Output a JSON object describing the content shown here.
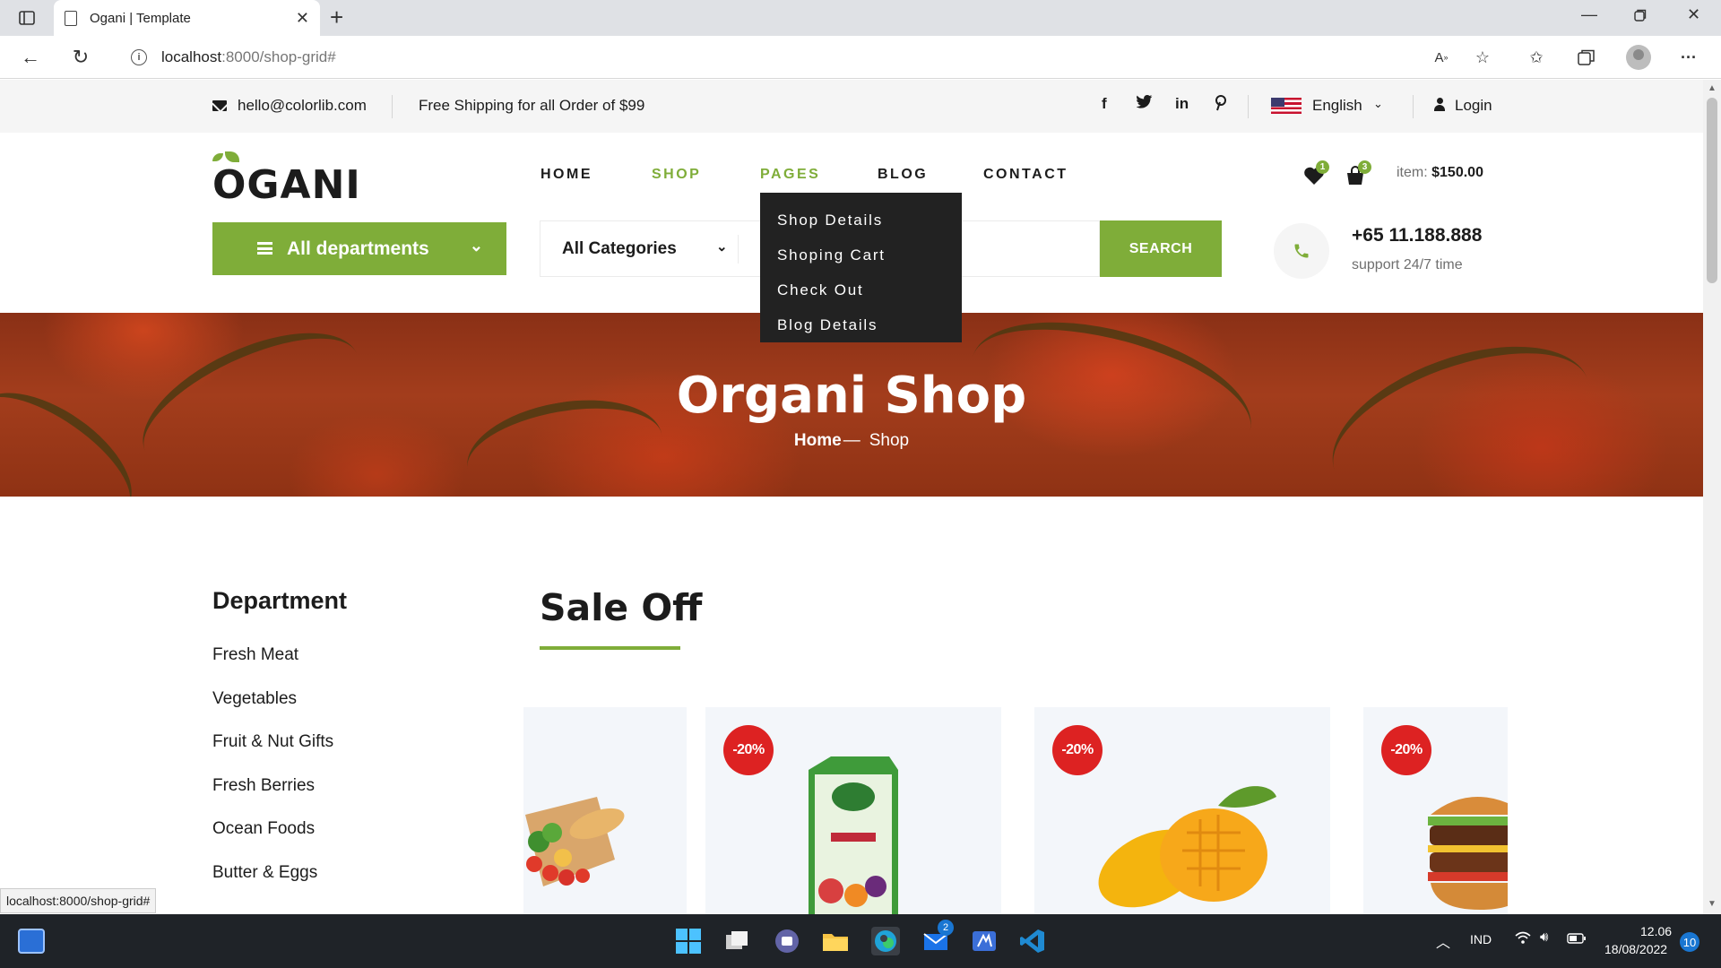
{
  "browser": {
    "tab_title": "Ogani | Template",
    "url_host": "localhost",
    "url_path": ":8000/shop-grid#",
    "status_url": "localhost:8000/shop-grid#"
  },
  "topbar": {
    "email": "hello@colorlib.com",
    "shipping": "Free Shipping for all Order of $99",
    "social": [
      "f",
      "t",
      "in",
      "p"
    ],
    "language": "English",
    "login": "Login"
  },
  "header": {
    "logo": "OGANI",
    "nav": [
      "HOME",
      "SHOP",
      "PAGES",
      "BLOG",
      "CONTACT"
    ],
    "wishlist_count": "1",
    "cart_count": "3",
    "item_label": "item:",
    "item_total": "$150.00",
    "pages_dropdown": [
      "Shop Details",
      "Shoping Cart",
      "Check Out",
      "Blog Details"
    ]
  },
  "search": {
    "departments": "All departments",
    "category": "All Categories",
    "placeholder": "",
    "button": "SEARCH"
  },
  "contact": {
    "phone": "+65 11.188.888",
    "support": "support 24/7 time"
  },
  "hero": {
    "title": "Organi Shop",
    "breadcrumb_home": "Home",
    "breadcrumb_sep": "—",
    "breadcrumb_current": "Shop"
  },
  "sidebar": {
    "title": "Department",
    "items": [
      "Fresh Meat",
      "Vegetables",
      "Fruit & Nut Gifts",
      "Fresh Berries",
      "Ocean Foods",
      "Butter & Eggs"
    ]
  },
  "sale": {
    "title": "Sale Off",
    "discounts": [
      "-20%",
      "-20%",
      "-20%"
    ]
  },
  "taskbar": {
    "lang": "IND",
    "time": "12.06",
    "date": "18/08/2022",
    "notif_count": "10",
    "mail_badge": "2"
  },
  "colors": {
    "brand": "#7fad39",
    "discount": "#dd2222",
    "dark": "#1c1c1c"
  }
}
